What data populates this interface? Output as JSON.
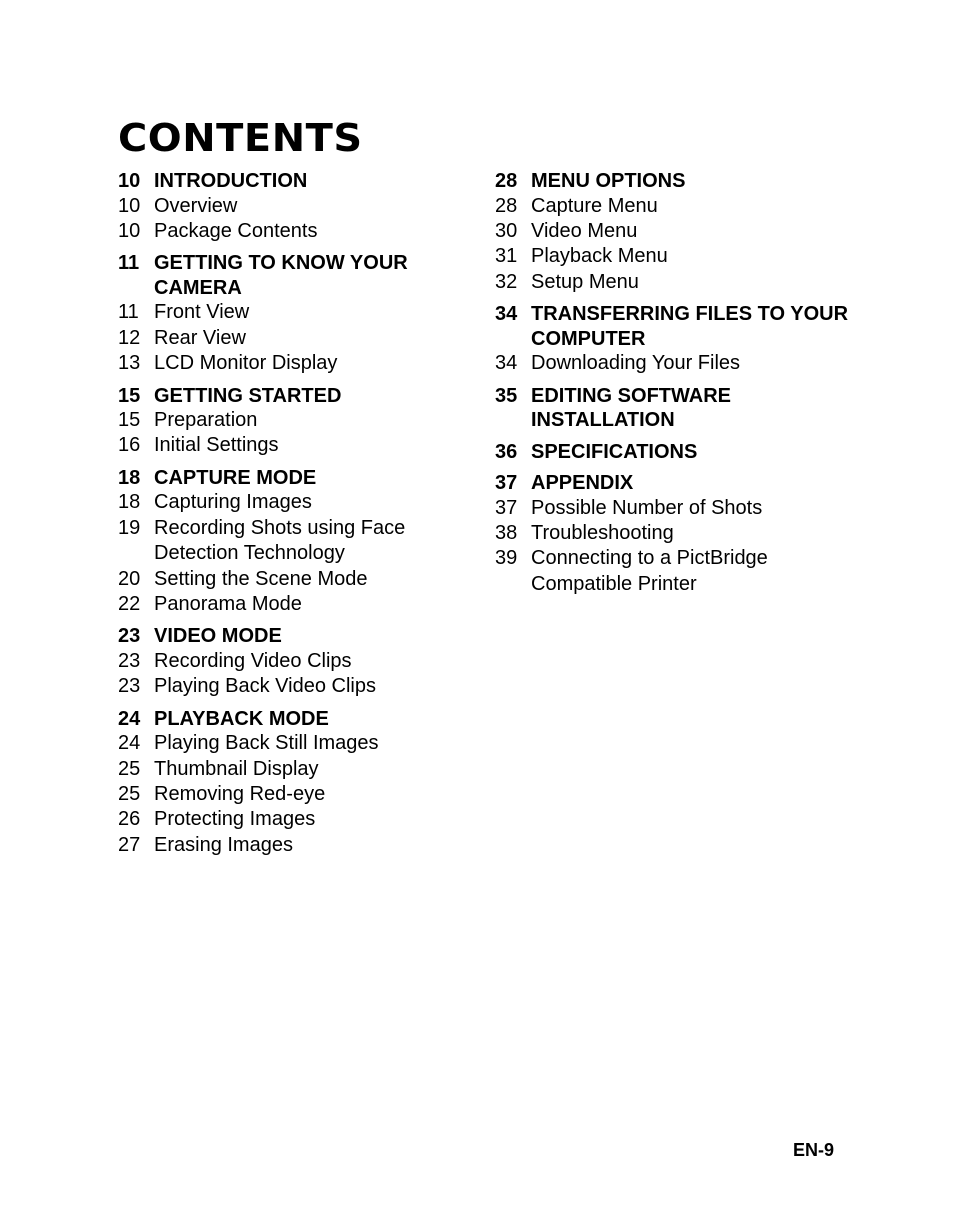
{
  "title": "CONTENTS",
  "left_column": [
    {
      "page": "10",
      "heading": "INTRODUCTION",
      "items": [
        {
          "page": "10",
          "label": "Overview"
        },
        {
          "page": "10",
          "label": "Package Contents"
        }
      ]
    },
    {
      "page": "11",
      "heading": "GETTING TO KNOW YOUR CAMERA",
      "items": [
        {
          "page": "11",
          "label": "Front View"
        },
        {
          "page": "12",
          "label": "Rear View"
        },
        {
          "page": "13",
          "label": "LCD Monitor Display"
        }
      ]
    },
    {
      "page": "15",
      "heading": "GETTING STARTED",
      "items": [
        {
          "page": "15",
          "label": "Preparation"
        },
        {
          "page": "16",
          "label": "Initial Settings"
        }
      ]
    },
    {
      "page": "18",
      "heading": "CAPTURE MODE",
      "items": [
        {
          "page": "18",
          "label": "Capturing Images"
        },
        {
          "page": "19",
          "label": "Recording Shots using Face Detection Technology"
        },
        {
          "page": "20",
          "label": "Setting the Scene Mode"
        },
        {
          "page": "22",
          "label": "Panorama Mode"
        }
      ]
    },
    {
      "page": "23",
      "heading": "VIDEO MODE",
      "items": [
        {
          "page": "23",
          "label": "Recording Video Clips"
        },
        {
          "page": "23",
          "label": "Playing Back Video Clips"
        }
      ]
    },
    {
      "page": "24",
      "heading": "PLAYBACK MODE",
      "items": [
        {
          "page": "24",
          "label": "Playing Back Still Images"
        },
        {
          "page": "25",
          "label": "Thumbnail Display"
        },
        {
          "page": "25",
          "label": "Removing Red-eye"
        },
        {
          "page": "26",
          "label": "Protecting Images"
        },
        {
          "page": "27",
          "label": "Erasing Images"
        }
      ]
    }
  ],
  "right_column": [
    {
      "page": "28",
      "heading": "MENU OPTIONS",
      "items": [
        {
          "page": "28",
          "label": "Capture Menu"
        },
        {
          "page": "30",
          "label": "Video Menu"
        },
        {
          "page": "31",
          "label": "Playback Menu"
        },
        {
          "page": "32",
          "label": "Setup Menu"
        }
      ]
    },
    {
      "page": "34",
      "heading": "TRANSFERRING FILES TO YOUR COMPUTER",
      "items": [
        {
          "page": "34",
          "label": "Downloading Your Files"
        }
      ]
    },
    {
      "page": "35",
      "heading": "EDITING SOFTWARE INSTALLATION",
      "items": []
    },
    {
      "page": "36",
      "heading": "SPECIFICATIONS",
      "items": []
    },
    {
      "page": "37",
      "heading": "APPENDIX",
      "items": [
        {
          "page": "37",
          "label": "Possible Number of Shots"
        },
        {
          "page": "38",
          "label": "Troubleshooting"
        },
        {
          "page": "39",
          "label": "Connecting to a PictBridge Compatible Printer"
        }
      ]
    }
  ],
  "footer": {
    "page_label": "EN-9"
  }
}
